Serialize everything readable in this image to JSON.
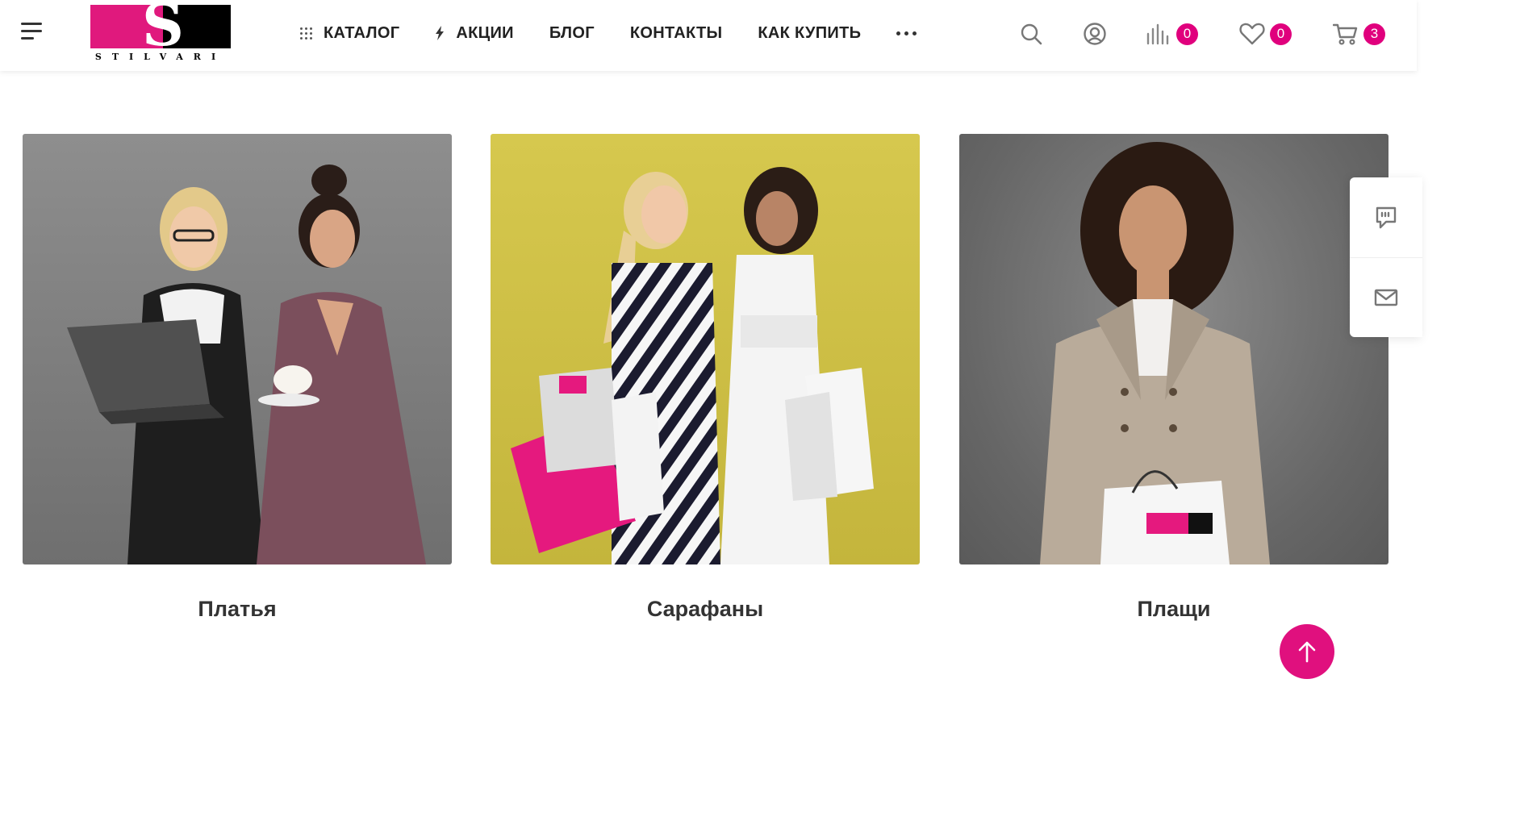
{
  "header": {
    "logo": {
      "letter": "S",
      "word": "STILVARI"
    },
    "nav": [
      {
        "label": "КАТАЛОГ",
        "icon": "grid-dots-icon"
      },
      {
        "label": "АКЦИИ",
        "icon": "lightning-icon"
      },
      {
        "label": "БЛОГ"
      },
      {
        "label": "КОНТАКТЫ"
      },
      {
        "label": "КАК КУПИТЬ"
      }
    ],
    "more": "more-horizontal-icon",
    "icons": {
      "search": "search-icon",
      "account": "user-circle-icon",
      "compare": {
        "icon": "compare-bars-icon",
        "count": "0"
      },
      "favorites": {
        "icon": "heart-icon",
        "count": "0"
      },
      "cart": {
        "icon": "cart-icon",
        "count": "3"
      }
    }
  },
  "categories": [
    {
      "label": "Платья",
      "bg": "#888888"
    },
    {
      "label": "Сарафаны",
      "bg": "#cfc243"
    },
    {
      "label": "Плащи",
      "bg": "#727272"
    }
  ],
  "side_widget": [
    "chat-bubble-icon",
    "envelope-icon"
  ],
  "scroll_top": "arrow-up-icon",
  "colors": {
    "accent": "#e0007d",
    "text": "#333333"
  }
}
